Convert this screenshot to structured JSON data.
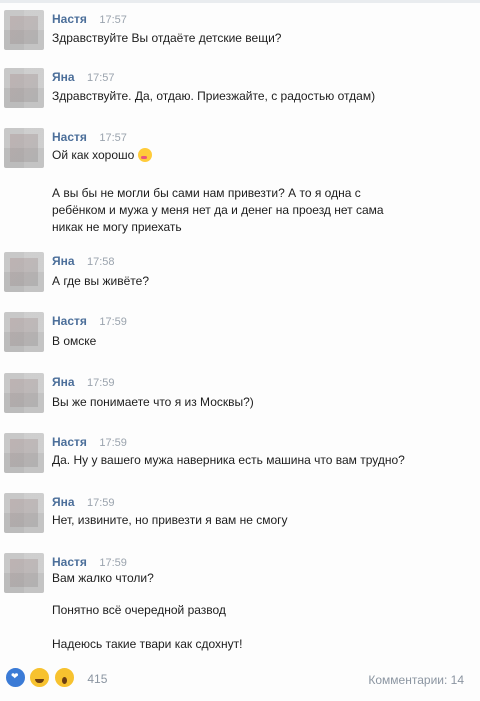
{
  "messages": [
    {
      "name": "Настя",
      "time": "17:57",
      "lines": [
        "Здравствуйте Вы отдаёте детские вещи?"
      ]
    },
    {
      "name": "Яна",
      "time": "17:57",
      "lines": [
        "Здравствуйте. Да, отдаю. Приезжайте, с радостью отдам)"
      ]
    },
    {
      "name": "Настя",
      "time": "17:57",
      "lines": [
        "Ой как хорошо"
      ],
      "extra_lines": [
        "А вы бы не могли бы сами нам привезти? А то я одна с",
        "ребёнком и мужа у меня нет да и денег на проезд нет сама",
        "никак не могу приехать"
      ]
    },
    {
      "name": "Яна",
      "time": "17:58",
      "lines": [
        "А где вы живёте?"
      ]
    },
    {
      "name": "Настя",
      "time": "17:59",
      "lines": [
        "В омске"
      ]
    },
    {
      "name": "Яна",
      "time": "17:59",
      "lines": [
        "Вы же понимаете что я из Москвы?)"
      ]
    },
    {
      "name": "Настя",
      "time": "17:59",
      "lines": [
        "Да. Ну у вашего мужа наверника есть машина что вам трудно?"
      ]
    },
    {
      "name": "Яна",
      "time": "17:59",
      "lines": [
        "Нет, извините, но привезти я вам не смогу"
      ]
    },
    {
      "name": "Настя",
      "time": "17:59",
      "lines": [
        "Вам жалко чтоли?"
      ],
      "extra_lines": [
        "Понятно всё очередной развод",
        "Надеюсь такие твари как сдохнут!"
      ]
    }
  ],
  "icons": {
    "kiss_emoji": "kissing-face-emoji"
  },
  "footer": {
    "reactions_count": "415",
    "comments_label": "Комментарии: 14"
  }
}
